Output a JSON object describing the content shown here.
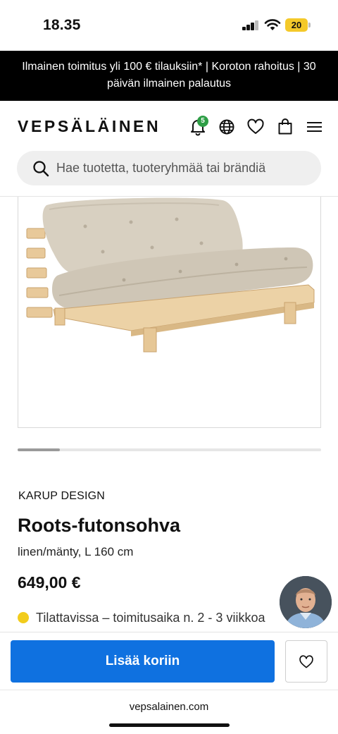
{
  "status_bar": {
    "time": "18.35",
    "battery": "20",
    "icons": [
      "cellular-signal-icon",
      "wifi-icon",
      "battery-icon"
    ]
  },
  "promo": {
    "text": "Ilmainen toimitus yli 100 € tilauksiin* | Koroton rahoitus | 30 päivän ilmainen palautus"
  },
  "header": {
    "logo": "VEPSÄLÄINEN",
    "notification_count": "5",
    "icons": [
      "bell-icon",
      "globe-icon",
      "heart-icon",
      "shopping-bag-icon",
      "menu-icon"
    ]
  },
  "search": {
    "placeholder": "Hae tuotetta, tuoteryhmää tai brändiä",
    "value": ""
  },
  "gallery": {
    "image": "futon-sofa-image",
    "position_fraction": 0.14
  },
  "product": {
    "brand": "KARUP DESIGN",
    "title": "Roots-futonsohva",
    "variant": "linen/mänty, L 160 cm",
    "price": "649,00 €",
    "availability": "Tilattavissa – toimitusaika n. 2 - 3 viikkoa",
    "availability_color": "#f2cc1c"
  },
  "actions": {
    "add_to_cart": "Lisää koriin",
    "add_to_cart_color": "#0f71e0"
  },
  "browser": {
    "url": "vepsalainen.com"
  }
}
